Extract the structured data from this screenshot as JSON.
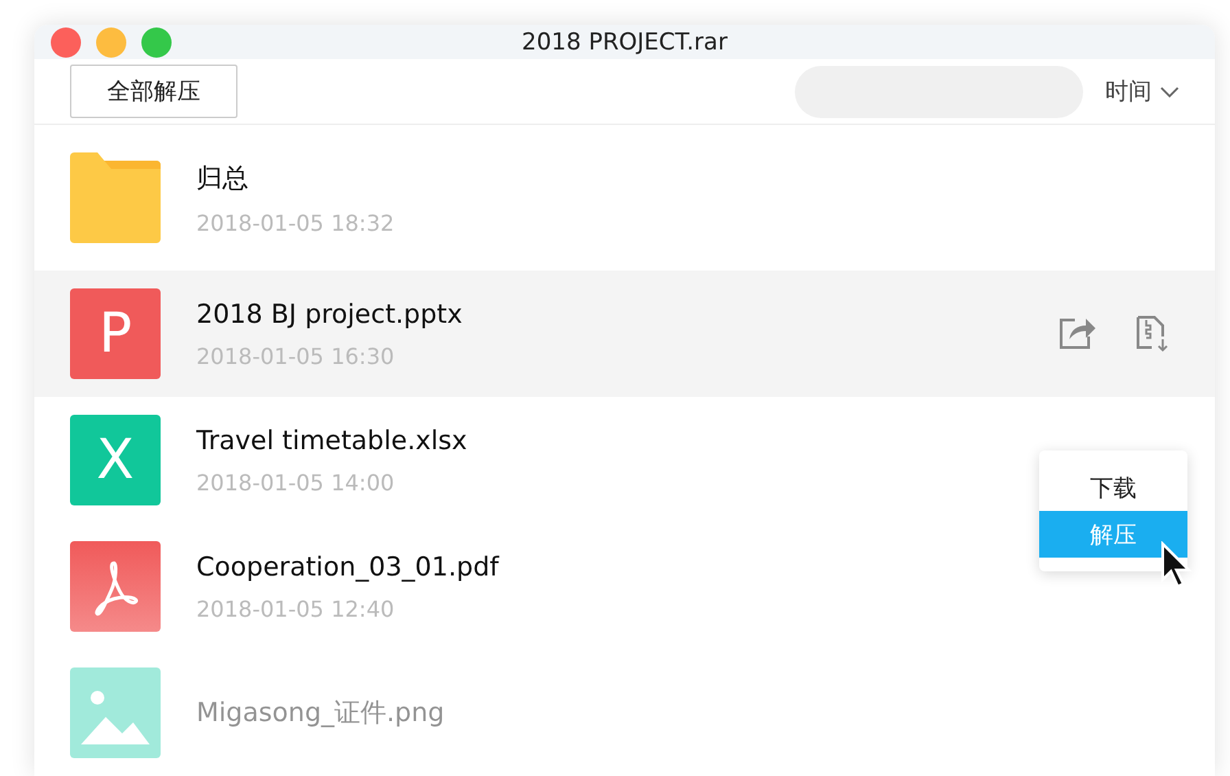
{
  "window": {
    "title": "2018 PROJECT.rar"
  },
  "toolbar": {
    "extract_all": "全部解压",
    "sort": "时间"
  },
  "files": [
    {
      "kind": "folder",
      "name": "归总",
      "date": "2018-01-05 18:32",
      "selected": false,
      "faded": false
    },
    {
      "kind": "ppt",
      "letter": "P",
      "name": "2018 BJ project.pptx",
      "date": "2018-01-05 16:30",
      "selected": true,
      "faded": false
    },
    {
      "kind": "xls",
      "letter": "X",
      "name": "Travel timetable.xlsx",
      "date": "2018-01-05 14:00",
      "selected": false,
      "faded": false
    },
    {
      "kind": "pdf",
      "name": "Cooperation_03_01.pdf",
      "date": "2018-01-05 12:40",
      "selected": false,
      "faded": false
    },
    {
      "kind": "image",
      "name": "Migasong_证件.png",
      "selected": false,
      "faded": true
    }
  ],
  "menu": [
    {
      "label": "下载",
      "selected": false
    },
    {
      "label": "解压",
      "selected": true
    }
  ]
}
